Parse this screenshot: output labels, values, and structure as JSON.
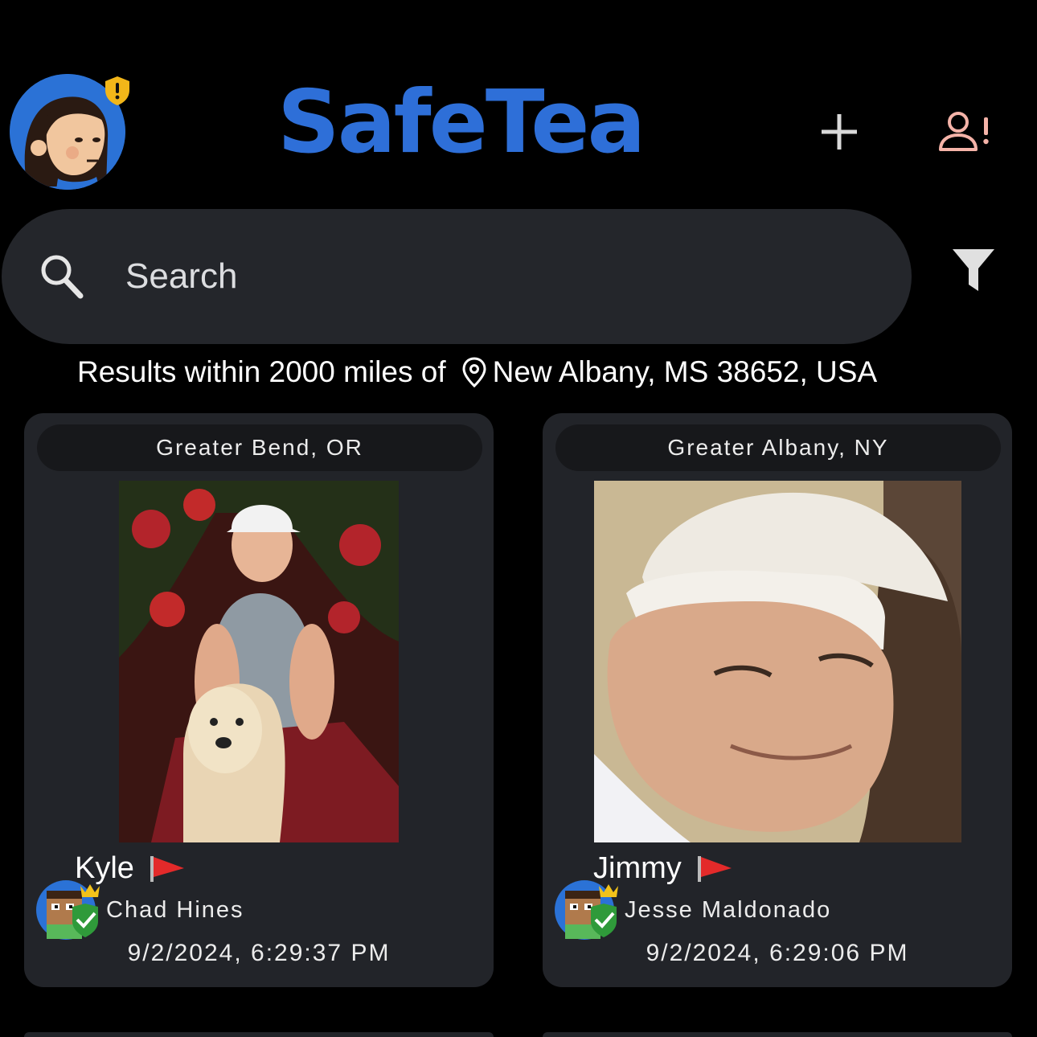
{
  "header": {
    "app_title": "SafeTea",
    "avatar_icon": "woman-avatar-icon",
    "badge_icon": "shield-alert-icon",
    "add_icon": "plus-icon",
    "report_icon": "user-alert-icon",
    "colors": {
      "brand": "#2e6fd8",
      "report": "#f5b3a8",
      "badge": "#f2b619"
    }
  },
  "search": {
    "placeholder": "Search",
    "icon": "search-icon",
    "filter_icon": "filter-icon"
  },
  "results": {
    "prefix": "Results within 2000 miles of",
    "location": "New Albany, MS 38652, USA",
    "pin_icon": "location-pin-icon"
  },
  "posts": [
    {
      "location": "Greater Bend, OR",
      "name": "Kyle",
      "flag_icon": "red-flag-icon",
      "poster": "Chad Hines",
      "timestamp": "9/2/2024, 6:29:37 PM"
    },
    {
      "location": "Greater Albany, NY",
      "name": "Jimmy",
      "flag_icon": "red-flag-icon",
      "poster": "Jesse Maldonado",
      "timestamp": "9/2/2024, 6:29:06 PM"
    }
  ]
}
